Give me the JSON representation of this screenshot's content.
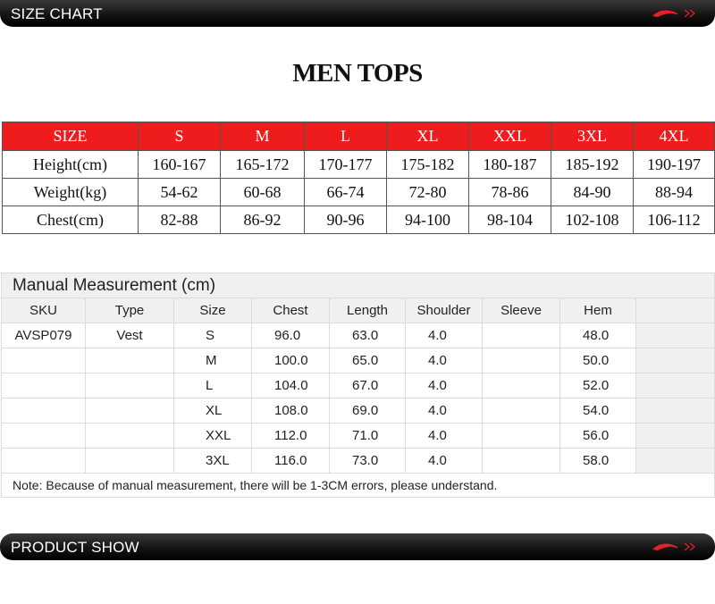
{
  "banners": {
    "top_title": "SIZE CHART",
    "bottom_title": "PRODUCT SHOW",
    "accent_color": "#e8202a"
  },
  "headline": "MEN TOPS",
  "size_chart": {
    "header": [
      "SIZE",
      "S",
      "M",
      "L",
      "XL",
      "XXL",
      "3XL",
      "4XL"
    ],
    "rows": [
      [
        "Height(cm)",
        "160-167",
        "165-172",
        "170-177",
        "175-182",
        "180-187",
        "185-192",
        "190-197"
      ],
      [
        "Weight(kg)",
        "54-62",
        "60-68",
        "66-74",
        "72-80",
        "78-86",
        "84-90",
        "88-94"
      ],
      [
        "Chest(cm)",
        "82-88",
        "86-92",
        "90-96",
        "94-100",
        "98-104",
        "102-108",
        "106-112"
      ]
    ],
    "header_color": "#ee1c1c"
  },
  "measurement": {
    "title": "Manual Measurement (cm)",
    "columns": [
      "SKU",
      "Type",
      "Size",
      "Chest",
      "Length",
      "Shoulder",
      "Sleeve",
      "Hem",
      ""
    ],
    "rows": [
      [
        "AVSP079",
        "Vest",
        "S",
        "96.0",
        "63.0",
        "4.0",
        "",
        "48.0",
        ""
      ],
      [
        "",
        "",
        "M",
        "100.0",
        "65.0",
        "4.0",
        "",
        "50.0",
        ""
      ],
      [
        "",
        "",
        "L",
        "104.0",
        "67.0",
        "4.0",
        "",
        "52.0",
        ""
      ],
      [
        "",
        "",
        "XL",
        "108.0",
        "69.0",
        "4.0",
        "",
        "54.0",
        ""
      ],
      [
        "",
        "",
        "XXL",
        "112.0",
        "71.0",
        "4.0",
        "",
        "56.0",
        ""
      ],
      [
        "",
        "",
        "3XL",
        "116.0",
        "73.0",
        "4.0",
        "",
        "58.0",
        ""
      ]
    ],
    "note": "Note: Because of manual measurement, there will be 1-3CM errors, please understand."
  }
}
